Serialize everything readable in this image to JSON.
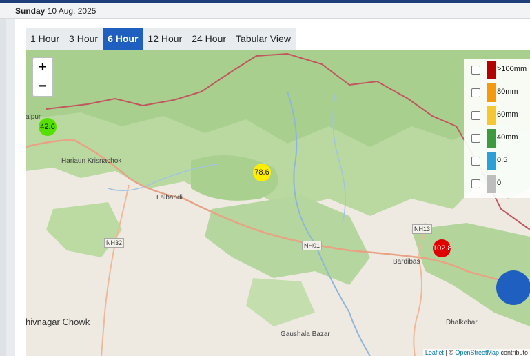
{
  "header": {
    "day": "Sunday",
    "date": "10 Aug, 2025"
  },
  "tabs": [
    {
      "label": "1 Hour",
      "active": false
    },
    {
      "label": "3 Hour",
      "active": false
    },
    {
      "label": "6 Hour",
      "active": true
    },
    {
      "label": "12 Hour",
      "active": false
    },
    {
      "label": "24 Hour",
      "active": false
    },
    {
      "label": "Tabular View",
      "active": false
    }
  ],
  "map": {
    "zoom_in": "+",
    "zoom_out": "−",
    "places": {
      "jalpur": "alpur",
      "hariaun": "Hariaun Krisnachok",
      "lalbandi": "Lalbandi",
      "bardibas": "Bardibas",
      "shivnagar": "hivnagar Chowk",
      "gaushala": "Gaushala Bazar",
      "dhalkebar": "Dhalkebar"
    },
    "roads": {
      "nh32": "NH32",
      "nh01": "NH01",
      "nh13": "NH13"
    },
    "attribution": {
      "leaflet": "Leaflet",
      "sep": " | © ",
      "osm": "OpenStreetMap",
      "contrib": " contributo"
    }
  },
  "legend": [
    {
      "label": ">100mm",
      "color": "#b30000"
    },
    {
      "label": "80mm",
      "color": "#f59a0c"
    },
    {
      "label": "60mm",
      "color": "#f5c832"
    },
    {
      "label": "40mm",
      "color": "#3d9a3d"
    },
    {
      "label": "0.5",
      "color": "#2aa0d6"
    },
    {
      "label": "0",
      "color": "#bdbdbd"
    }
  ],
  "stations": [
    {
      "value": "42.6",
      "color": "#55e000"
    },
    {
      "value": "78.6",
      "color": "#ffee00"
    },
    {
      "value": "102.8",
      "color": "#e00000"
    }
  ]
}
